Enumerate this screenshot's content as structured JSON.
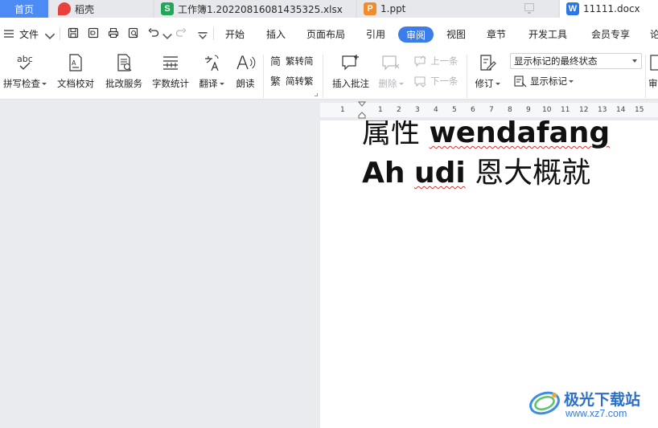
{
  "tabs": {
    "home": "首页",
    "items": [
      {
        "label": "稻壳",
        "badge": "",
        "color": "#e8413c"
      },
      {
        "label": "工作簿1.20220816081435325.xlsx",
        "badge": "S",
        "color": "#23a55a"
      },
      {
        "label": "1.ppt",
        "badge": "P",
        "color": "#f08c2d"
      },
      {
        "label": "11111.docx",
        "badge": "W",
        "color": "#2b78e4"
      }
    ]
  },
  "menubar": {
    "file": "文件",
    "items": [
      "开始",
      "插入",
      "页面布局",
      "引用",
      "审阅",
      "视图",
      "章节",
      "开发工具",
      "会员专享",
      "论"
    ],
    "active": "审阅"
  },
  "ribbon": {
    "spellcheck": "拼写检查",
    "doc_proof": "文档校对",
    "review_service": "批改服务",
    "word_count": "字数统计",
    "translate": "翻译",
    "read_aloud": "朗读",
    "trad_to_simp": "繁转简",
    "simp_to_trad": "简转繁",
    "insert_comment": "插入批注",
    "delete": "删除",
    "prev": "上一条",
    "next": "下一条",
    "track_changes": "修订",
    "markup_select": "显示标记的最终状态",
    "show_markup": "显示标记",
    "review_cut": "审"
  },
  "ruler": {
    "numbers": [
      "1",
      "1",
      "2",
      "3",
      "4",
      "5",
      "6",
      "7",
      "8",
      "9",
      "10",
      "11",
      "12",
      "13",
      "14",
      "15"
    ]
  },
  "document": {
    "line1_cjk": "属性",
    "line1_latin": "wendafang",
    "line2_latin_a": "Ah",
    "line2_latin_b": "udi",
    "line2_cjk": "恩大概就"
  },
  "watermark": {
    "title": "极光下载站",
    "url": "www.xz7.com"
  },
  "colors": {
    "accent": "#3b7de9",
    "home_tab": "#4c8bf5",
    "spell_underline": "#dd3333"
  }
}
